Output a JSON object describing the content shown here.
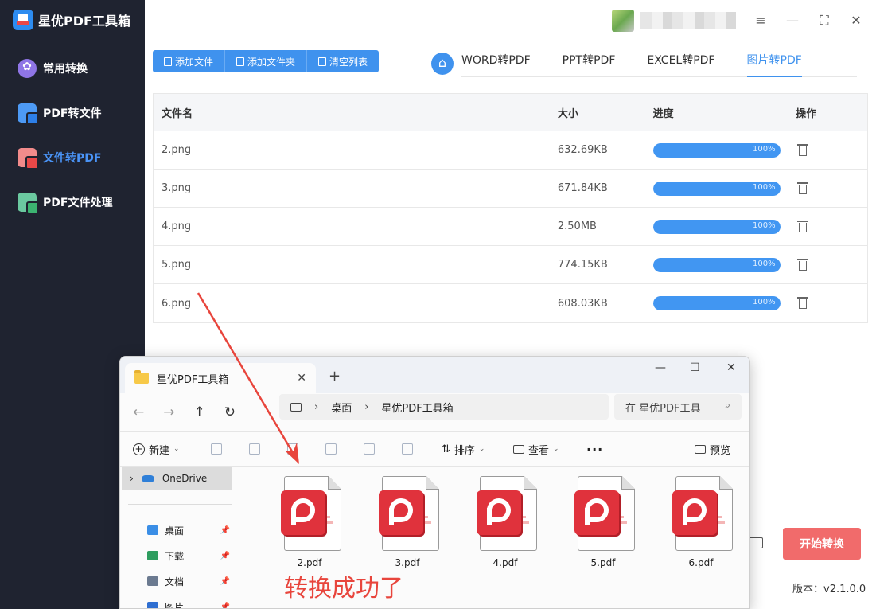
{
  "app": {
    "name": "星优PDF工具箱",
    "version_label": "版本：v2.1.0.0"
  },
  "sidebar": {
    "items": [
      {
        "label": "常用转换",
        "icon": "common-convert-icon"
      },
      {
        "label": "PDF转文件",
        "icon": "pdf-to-file-icon"
      },
      {
        "label": "文件转PDF",
        "icon": "file-to-pdf-icon",
        "active": true
      },
      {
        "label": "PDF文件处理",
        "icon": "pdf-process-icon"
      }
    ]
  },
  "toolbar": {
    "add_file": "添加文件",
    "add_folder": "添加文件夹",
    "clear_list": "清空列表"
  },
  "tabs": [
    {
      "label": "WORD转PDF"
    },
    {
      "label": "PPT转PDF"
    },
    {
      "label": "EXCEL转PDF"
    },
    {
      "label": "图片转PDF",
      "active": true
    }
  ],
  "table": {
    "headers": {
      "name": "文件名",
      "size": "大小",
      "progress": "进度",
      "action": "操作"
    },
    "rows": [
      {
        "name": "2.png",
        "size": "632.69KB",
        "progress": 100,
        "progress_label": "100%"
      },
      {
        "name": "3.png",
        "size": "671.84KB",
        "progress": 100,
        "progress_label": "100%"
      },
      {
        "name": "4.png",
        "size": "2.50MB",
        "progress": 100,
        "progress_label": "100%"
      },
      {
        "name": "5.png",
        "size": "774.15KB",
        "progress": 100,
        "progress_label": "100%"
      },
      {
        "name": "6.png",
        "size": "608.03KB",
        "progress": 100,
        "progress_label": "100%"
      }
    ]
  },
  "start_button": "开始转换",
  "explorer": {
    "tab_title": "星优PDF工具箱",
    "breadcrumb": [
      "桌面",
      "星优PDF工具箱"
    ],
    "search_placeholder": "在 星优PDF工具",
    "commands": {
      "new": "新建",
      "sort": "排序",
      "view": "查看",
      "more": "···",
      "preview": "预览"
    },
    "nav": {
      "onedrive": "OneDrive",
      "quick_access": [
        {
          "label": "桌面",
          "icon_color": "#3a8ee6"
        },
        {
          "label": "下载",
          "icon_color": "#2e9d5f"
        },
        {
          "label": "文档",
          "icon_color": "#6b7a90"
        },
        {
          "label": "图片",
          "icon_color": "#2f6fd1"
        }
      ]
    },
    "files": [
      "2.pdf",
      "3.pdf",
      "4.pdf",
      "5.pdf",
      "6.pdf"
    ]
  },
  "annotation": "转换成功了",
  "colors": {
    "accent": "#3f92ee",
    "danger": "#f16b6b",
    "sidebar": "#1f2330"
  }
}
